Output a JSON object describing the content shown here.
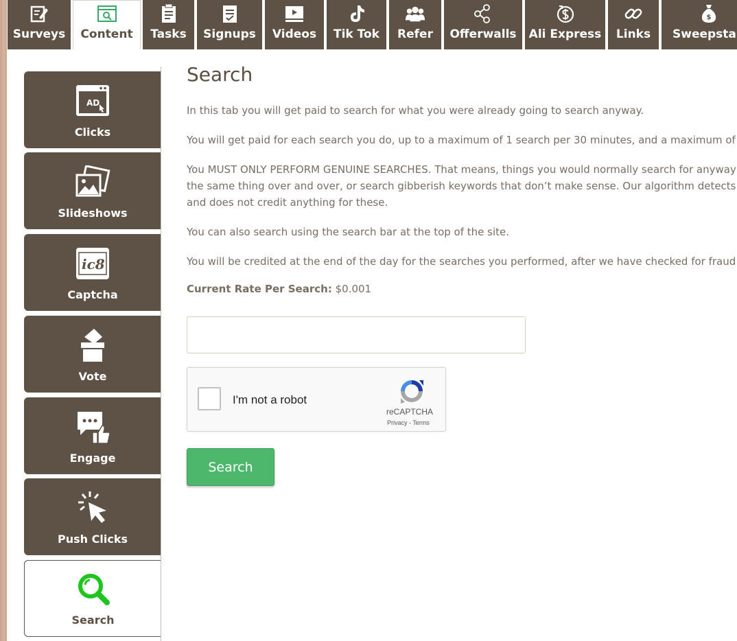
{
  "topnav": {
    "tabs": [
      {
        "label": "Surveys",
        "icon": "survey-pencil-icon"
      },
      {
        "label": "Content",
        "icon": "content-window-icon",
        "active": true
      },
      {
        "label": "Tasks",
        "icon": "clipboard-icon"
      },
      {
        "label": "Signups",
        "icon": "form-icon"
      },
      {
        "label": "Videos",
        "icon": "video-icon"
      },
      {
        "label": "Tik Tok",
        "icon": "tiktok-icon"
      },
      {
        "label": "Refer",
        "icon": "people-icon"
      },
      {
        "label": "Offerwalls",
        "icon": "share-icon"
      },
      {
        "label": "Ali Express",
        "icon": "dollar-circle-icon"
      },
      {
        "label": "Links",
        "icon": "link-icon"
      },
      {
        "label": "Sweepstakes",
        "icon": "money-bag-icon"
      }
    ]
  },
  "sidebar": {
    "items": [
      {
        "label": "Clicks",
        "icon": "ad-click-icon"
      },
      {
        "label": "Slideshows",
        "icon": "slideshow-icon"
      },
      {
        "label": "Captcha",
        "icon": "captcha-icon"
      },
      {
        "label": "Vote",
        "icon": "vote-box-icon"
      },
      {
        "label": "Engage",
        "icon": "engage-icon"
      },
      {
        "label": "Push Clicks",
        "icon": "pointer-click-icon"
      },
      {
        "label": "Search",
        "icon": "search-icon",
        "active": true
      }
    ]
  },
  "main": {
    "title": "Search",
    "p1": "In this tab you will get paid to search for what you were already going to search anyway.",
    "p2": "You will get paid for each search you do, up to a maximum of 1 search per 30 minutes, and a maximum of",
    "p3": "You MUST ONLY PERFORM GENUINE SEARCHES. That means, things you would normally search for anyway",
    "p3b": "the same thing over and over, or search gibberish keywords that don’t make sense. Our algorithm detects",
    "p3c": "and does not credit anything for these.",
    "p4": "You can also search using the search bar at the top of the site.",
    "p5": "You will be credited at the end of the day for the searches you performed, after we have checked for fraud",
    "rate_label": "Current Rate Per Search:",
    "rate_value": "$0.001",
    "search_input_value": "",
    "search_button": "Search"
  },
  "captcha": {
    "label": "I'm not a robot",
    "brand": "reCAPTCHA",
    "privacy": "Privacy",
    "separator": " - ",
    "terms": "Terms"
  },
  "colors": {
    "tab_bg": "#5e5145",
    "button_green": "#4db86b",
    "active_icon_green": "#1fc51f"
  }
}
